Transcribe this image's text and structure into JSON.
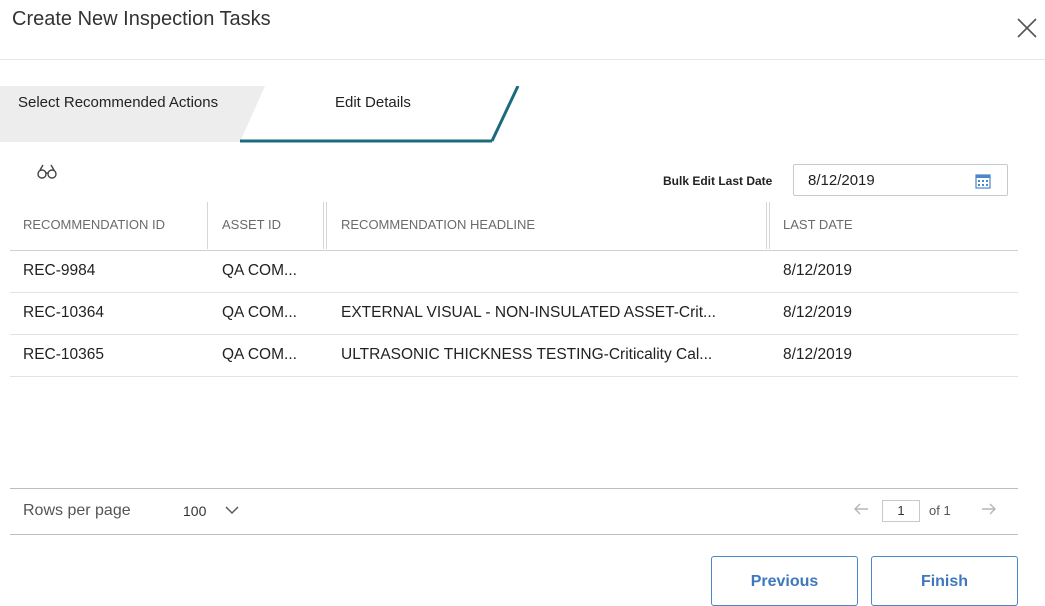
{
  "dialog": {
    "title": "Create New Inspection Tasks"
  },
  "wizard": {
    "steps": [
      {
        "label": "Select Recommended Actions",
        "state": "completed"
      },
      {
        "label": "Edit Details",
        "state": "active"
      }
    ],
    "accent_color": "#1c6a7d"
  },
  "toolbar": {
    "find_icon": "binoculars-icon",
    "bulk_edit_label": "Bulk Edit Last Date",
    "bulk_edit_value": "8/12/2019",
    "calendar_icon": "calendar-icon"
  },
  "table": {
    "columns": [
      "RECOMMENDATION ID",
      "ASSET ID",
      "RECOMMENDATION HEADLINE",
      "LAST DATE"
    ],
    "rows": [
      {
        "id": "REC-9984",
        "asset": "QA COM...",
        "headline": "",
        "last_date": "8/12/2019"
      },
      {
        "id": "REC-10364",
        "asset": "QA COM...",
        "headline": "EXTERNAL VISUAL - NON-INSULATED ASSET-Crit...",
        "last_date": "8/12/2019"
      },
      {
        "id": "REC-10365",
        "asset": "QA COM...",
        "headline": "ULTRASONIC THICKNESS TESTING-Criticality Cal...",
        "last_date": "8/12/2019"
      }
    ]
  },
  "pager": {
    "rows_per_page_label": "Rows per page",
    "rows_per_page_value": "100",
    "current_page": "1",
    "of_label": "of 1"
  },
  "footer": {
    "previous_label": "Previous",
    "finish_label": "Finish",
    "button_color": "#3d78bf"
  }
}
